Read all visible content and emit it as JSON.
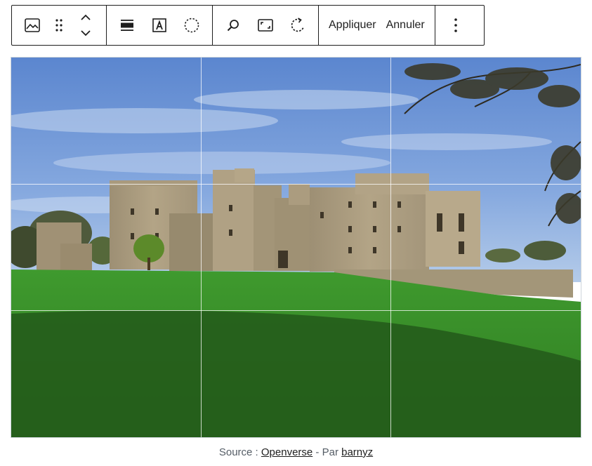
{
  "toolbar": {
    "group1": {
      "image_icon": "image-icon",
      "drag_icon": "drag-handle-icon",
      "move_up_icon": "chevron-up-icon",
      "move_down_icon": "chevron-down-icon"
    },
    "group2": {
      "align_icon": "align-wide-icon",
      "text_overlay_icon": "text-overlay-icon",
      "duotone_icon": "duotone-icon"
    },
    "group3": {
      "zoom_icon": "zoom-icon",
      "aspect_icon": "aspect-ratio-icon",
      "rotate_icon": "rotate-icon"
    },
    "apply_label": "Appliquer",
    "cancel_label": "Annuler",
    "more_icon": "more-vertical-icon"
  },
  "image": {
    "description_colors": {
      "sky": "#4a7cc9",
      "grass": "#3a8a2a",
      "stone": "#a89878"
    }
  },
  "caption": {
    "prefix": "Source : ",
    "source_link": "Openverse",
    "separator": " - Par ",
    "author_link": "barnyz"
  },
  "colors": {
    "border": "#1e1e1e",
    "caption_text": "#555d66"
  }
}
